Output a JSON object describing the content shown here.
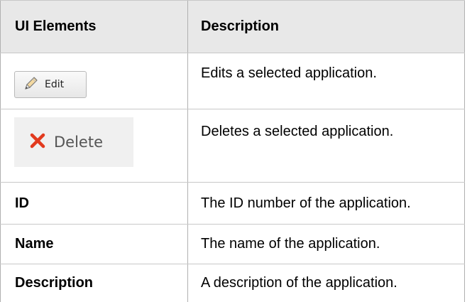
{
  "table": {
    "headers": {
      "col1": "UI Elements",
      "col2": "Description"
    },
    "rows": [
      {
        "element": {
          "type": "button",
          "label": "Edit",
          "icon": "pencil-icon"
        },
        "description": "Edits a selected application."
      },
      {
        "element": {
          "type": "button",
          "label": "Delete",
          "icon": "red-x-icon"
        },
        "description": "Deletes a selected application."
      },
      {
        "element": "ID",
        "description": "The ID number of the application."
      },
      {
        "element": "Name",
        "description": "The name of the application."
      },
      {
        "element": "Description",
        "description": "A description of the application."
      }
    ]
  },
  "colors": {
    "header_bg": "#e8e8e8",
    "delete_icon": "#e23a1e",
    "border": "#b0b0b0"
  }
}
